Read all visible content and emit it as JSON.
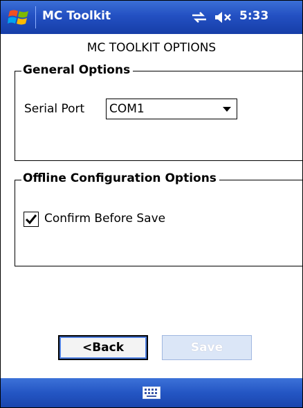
{
  "colors": {
    "titlebar": "#2350c2",
    "menubar": "#2456c4",
    "save_disabled": "#dbe6f7"
  },
  "titlebar": {
    "app_title": "MC Toolkit",
    "time": "5:33",
    "icons": [
      "windows-start-icon",
      "connectivity-icon",
      "volume-muted-icon"
    ]
  },
  "header": "MC TOOLKIT OPTIONS",
  "general": {
    "title": "General Options",
    "serial_label": "Serial Port",
    "serial_value": "COM1"
  },
  "offline": {
    "title": "Offline Configuration Options",
    "confirm_label": "Confirm Before Save",
    "confirm_checked": true
  },
  "buttons": {
    "back": "<Back",
    "save": "Save"
  },
  "menubar": {
    "icons": [
      "keyboard-icon"
    ]
  }
}
